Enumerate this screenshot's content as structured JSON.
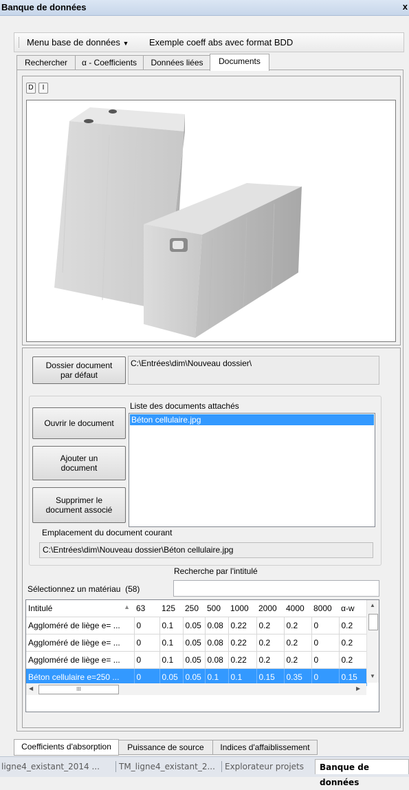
{
  "window": {
    "title": "Banque de données",
    "close_glyph": "x"
  },
  "menustrip": {
    "menu_label": "Menu base de données",
    "item_label": "Exemple coeff abs avec format BDD"
  },
  "tabs": [
    "Rechercher",
    "α - Coefficients",
    "Données liées",
    "Documents"
  ],
  "selected_tab": "Documents",
  "preview": {
    "btn_d": "D",
    "btn_i": "I",
    "image_icon": "aerated-concrete-blocks-image"
  },
  "folder": {
    "button_label_1": "Dossier document",
    "button_label_2": "par défaut",
    "path": "C:\\Entrées\\dim\\Nouveau dossier\\"
  },
  "documents": {
    "list_label": "Liste des documents attachés",
    "items": [
      "Béton cellulaire.jpg"
    ],
    "open_1": "Ouvrir le document",
    "add_1": "Ajouter un",
    "add_2": "document",
    "delete_1": "Supprimer le",
    "delete_2": "document associé",
    "location_label": "Emplacement du document courant",
    "location_path": "C:\\Entrées\\dim\\Nouveau dossier\\Béton cellulaire.jpg"
  },
  "search": {
    "select_label": "Sélectionnez un matériau  (58)",
    "search_label": "Recherche par l'intitulé",
    "search_value": ""
  },
  "grid": {
    "headers": [
      "Intitulé",
      "63",
      "125",
      "250",
      "500",
      "1000",
      "2000",
      "4000",
      "8000",
      "α-w"
    ],
    "rows": [
      [
        "Aggloméré de liège e= ...",
        "0",
        "0.1",
        "0.05",
        "0.08",
        "0.22",
        "0.2",
        "0.2",
        "0",
        "0.2"
      ],
      [
        "Aggloméré de liège e= ...",
        "0",
        "0.1",
        "0.05",
        "0.08",
        "0.22",
        "0.2",
        "0.2",
        "0",
        "0.2"
      ],
      [
        "Aggloméré de liège e= ...",
        "0",
        "0.1",
        "0.05",
        "0.08",
        "0.22",
        "0.2",
        "0.2",
        "0",
        "0.2"
      ],
      [
        "Béton cellulaire e=250 ...",
        "0",
        "0.05",
        "0.05",
        "0.1",
        "0.1",
        "0.15",
        "0.35",
        "0",
        "0.15"
      ]
    ],
    "selected_row": 3,
    "hscroll_grip": "III"
  },
  "bottom_tabs": [
    "Coefficients d'absorption",
    "Puissance de source",
    "Indices d'affaiblissement"
  ],
  "doc_tabs": [
    "ligne4_existant_2014 ...",
    "TM_ligne4_existant_2...",
    "Explorateur projets",
    "Banque de données"
  ],
  "colors": {
    "selection": "#3399ff",
    "panel": "#f0f0f0"
  }
}
